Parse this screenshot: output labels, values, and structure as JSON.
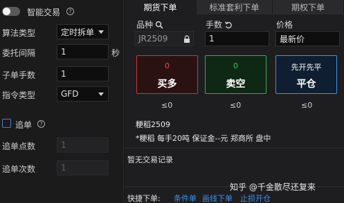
{
  "left": {
    "smart_trade_label": "智能交易",
    "algo_type_label": "算法类型",
    "algo_type_value": "定时拆单",
    "interval_label": "委托间隔",
    "interval_value": "1",
    "interval_unit": "秒",
    "sub_qty_label": "子单手数",
    "sub_qty_value": "1",
    "order_type_label": "指令类型",
    "order_type_value": "GFD",
    "chase_label": "追单",
    "chase_points_label": "追单点数",
    "chase_points_value": "1",
    "chase_count_label": "追单次数",
    "chase_count_value": "1"
  },
  "tabs": [
    "期货下单",
    "标准套利下单",
    "期权下单"
  ],
  "order": {
    "symbol_label": "品种",
    "symbol_value": "JR2509",
    "qty_label": "手数",
    "qty_value": "1",
    "price_label": "价格",
    "price_value": "最新价",
    "buy": {
      "count": "0",
      "label": "买多",
      "limit": "≤0"
    },
    "sell": {
      "count": "0",
      "label": "卖空",
      "limit": "≤0"
    },
    "close": {
      "mode": "先开先平",
      "label": "平仓",
      "limit": "≤0"
    },
    "instrument_name": "粳稻2509",
    "instrument_desc": "*粳稻 每手20吨 保证金--元 郑商所 盘中"
  },
  "records": {
    "empty_text": "暂无交易记录"
  },
  "quick": {
    "label": "快捷下单:",
    "links": [
      "条件单",
      "画线下单",
      "止损开仓"
    ]
  },
  "watermark": "知乎 @千金散尽还复来",
  "colors": {
    "buy": "#c23a3a",
    "sell": "#2fae55",
    "close": "#4b8fe0",
    "link": "#3f8fe8"
  }
}
